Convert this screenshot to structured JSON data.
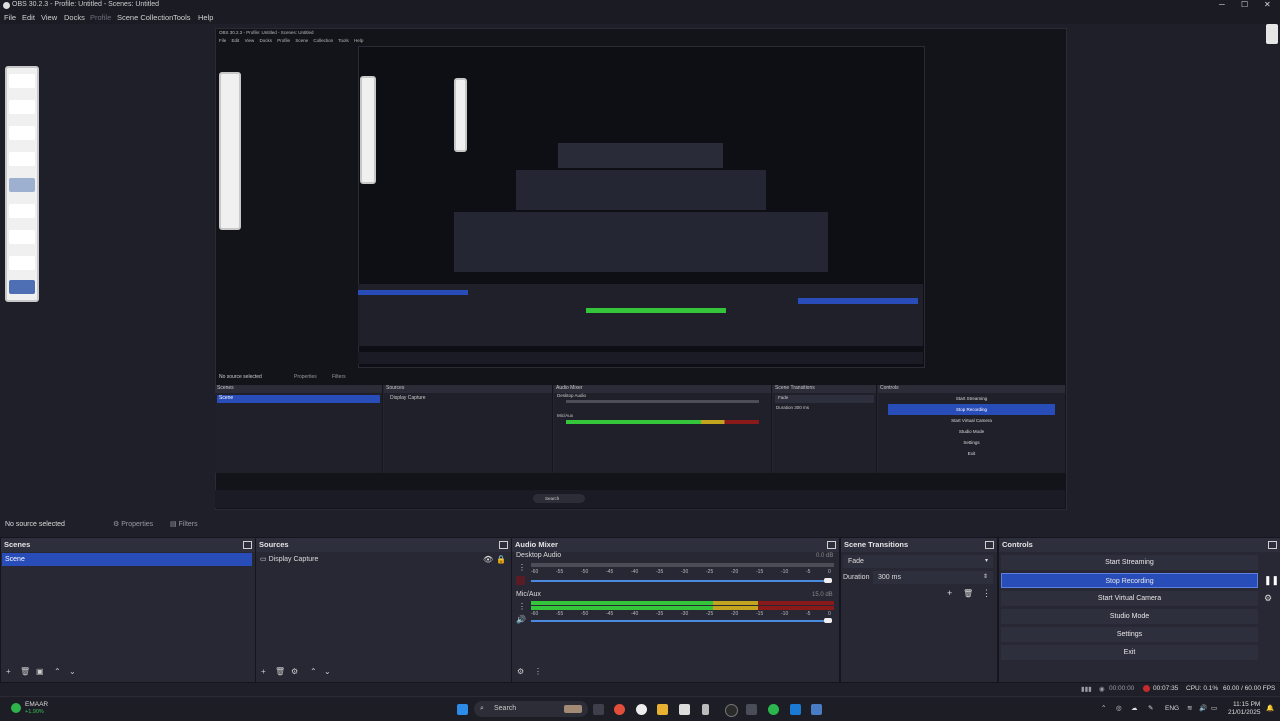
{
  "window": {
    "title": "OBS 30.2.3 - Profile: Untitled - Scenes: Untitled",
    "controls": [
      "─",
      "☐",
      "✕"
    ]
  },
  "menu": [
    "File",
    "Edit",
    "View",
    "Docks",
    "Profile",
    "Scene Collection",
    "Tools",
    "Help"
  ],
  "nested": {
    "title": "OBS 30.2.3 - Profile: Untitled - Scenes: Untitled",
    "menu": [
      "File",
      "Edit",
      "View",
      "Docks",
      "Profile",
      "Scene Collection",
      "Tools",
      "Help"
    ],
    "status": "No source selected",
    "props": "Properties",
    "filters": "Filters",
    "docks": [
      "Scenes",
      "Sources",
      "Audio Mixer",
      "Scene Transitions",
      "Controls"
    ],
    "scene": "Scene",
    "source": "Display Capture",
    "desktop": "Desktop Audio",
    "mic": "Mic/Aux",
    "fade": "Fade",
    "duration": "Duration",
    "ms": "300 ms",
    "ctrl": [
      "Start Streaming",
      "Stop Recording",
      "Start Virtual Camera",
      "Studio Mode",
      "Settings",
      "Exit"
    ],
    "taskbar_search": "Search"
  },
  "statusbar": {
    "no_source": "No source selected",
    "properties": "Properties",
    "filters": "Filters"
  },
  "scenes": {
    "title": "Scenes",
    "items": [
      "Scene"
    ]
  },
  "sources": {
    "title": "Sources",
    "items": [
      "Display Capture"
    ]
  },
  "mixer": {
    "title": "Audio Mixer",
    "channels": [
      {
        "name": "Desktop Audio",
        "db": "0.0 dB",
        "level": 0.0
      },
      {
        "name": "Mic/Aux",
        "db": "15.0 dB",
        "level": 0.82
      }
    ],
    "ticks": [
      "-60",
      "-55",
      "-50",
      "-45",
      "-40",
      "-35",
      "-30",
      "-25",
      "-20",
      "-15",
      "-10",
      "-5",
      "0"
    ]
  },
  "transitions": {
    "title": "Scene Transitions",
    "selected": "Fade",
    "duration_label": "Duration",
    "duration_value": "300 ms"
  },
  "controls": {
    "title": "Controls",
    "buttons": [
      "Start Streaming",
      "Stop Recording",
      "Start Virtual Camera",
      "Studio Mode",
      "Settings",
      "Exit"
    ],
    "active": "Stop Recording"
  },
  "bottom": {
    "live_time": "00:00:00",
    "rec_time": "00:07:35",
    "cpu": "CPU: 0.1%",
    "fps": "60.00 / 60.00 FPS"
  },
  "taskbar": {
    "weather_name": "EMAAR",
    "weather_change": "+1.90%",
    "search": "Search",
    "lang": "ENG",
    "time": "11:15 PM",
    "date": "21/01/2025"
  }
}
